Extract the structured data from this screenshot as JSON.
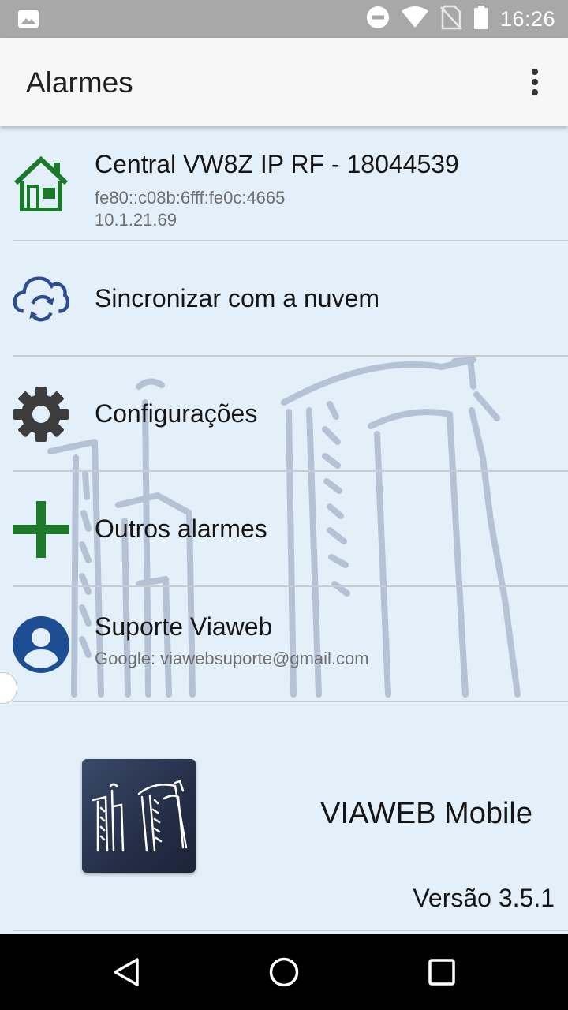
{
  "status_bar": {
    "time": "16:26",
    "icons": [
      "image-icon",
      "do-not-disturb-icon",
      "wifi-icon",
      "no-sim-icon",
      "battery-icon"
    ]
  },
  "app_bar": {
    "title": "Alarmes",
    "overflow_icon": "more-vert-icon"
  },
  "menu": {
    "items": [
      {
        "icon": "home-icon",
        "title": "Central VW8Z IP RF - 18044539",
        "lines": [
          "fe80::c08b:6fff:fe0c:4665",
          "10.1.21.69"
        ]
      },
      {
        "icon": "cloud-sync-icon",
        "title": "Sincronizar com a nuvem"
      },
      {
        "icon": "gear-icon",
        "title": "Configurações"
      },
      {
        "icon": "plus-icon",
        "title": "Outros alarmes"
      },
      {
        "icon": "account-icon",
        "title": "Suporte Viaweb",
        "lines": [
          "Google: viawebsuporte@gmail.com"
        ]
      }
    ]
  },
  "about": {
    "app_name": "VIAWEB Mobile",
    "version": "Versão 3.5.1"
  },
  "colors": {
    "status_bar": "#a8a8a8",
    "app_bar": "#f7f7f7",
    "content_bg": "#e3f0f9",
    "home_green": "#1b7a2a",
    "sync_blue": "#2e4d8f",
    "gear_gray": "#3d3d3d",
    "plus_green": "#1e7a2b",
    "account_blue": "#1d4e93"
  },
  "nav_bar": {
    "icons": [
      "back-icon",
      "home-circle-icon",
      "recents-icon"
    ]
  }
}
